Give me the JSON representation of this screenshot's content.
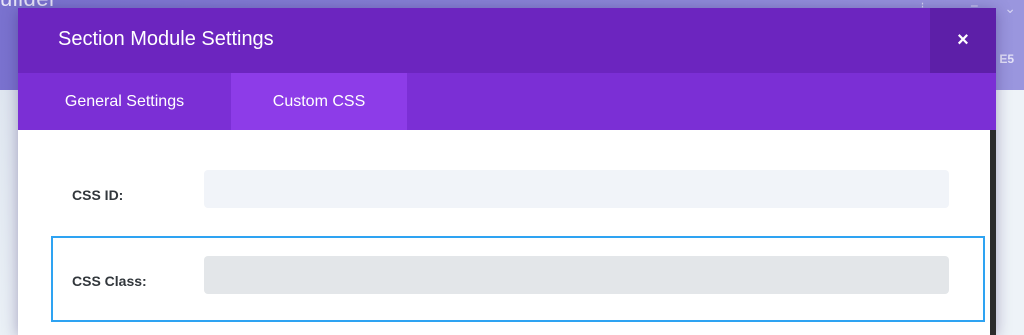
{
  "background": {
    "title_fragment": "uilder",
    "icons": [
      "download-icon",
      "hamburger-icon",
      "chevron-down-icon",
      "bolt-icon"
    ],
    "side_icon_text": "E5"
  },
  "modal": {
    "title": "Section Module Settings",
    "close_label": "×",
    "header_color": "#6c25bf",
    "tabbar_color": "#7b2fd5",
    "active_tab_color": "#8d3ce8",
    "tabs": [
      {
        "label": "General Settings",
        "active": false
      },
      {
        "label": "Custom CSS",
        "active": true
      }
    ],
    "fields": [
      {
        "label": "CSS ID:",
        "value": "",
        "placeholder": ""
      },
      {
        "label": "CSS Class:",
        "value": "",
        "placeholder": "",
        "focused": true
      }
    ],
    "focus_color": "#2ea3f2"
  }
}
